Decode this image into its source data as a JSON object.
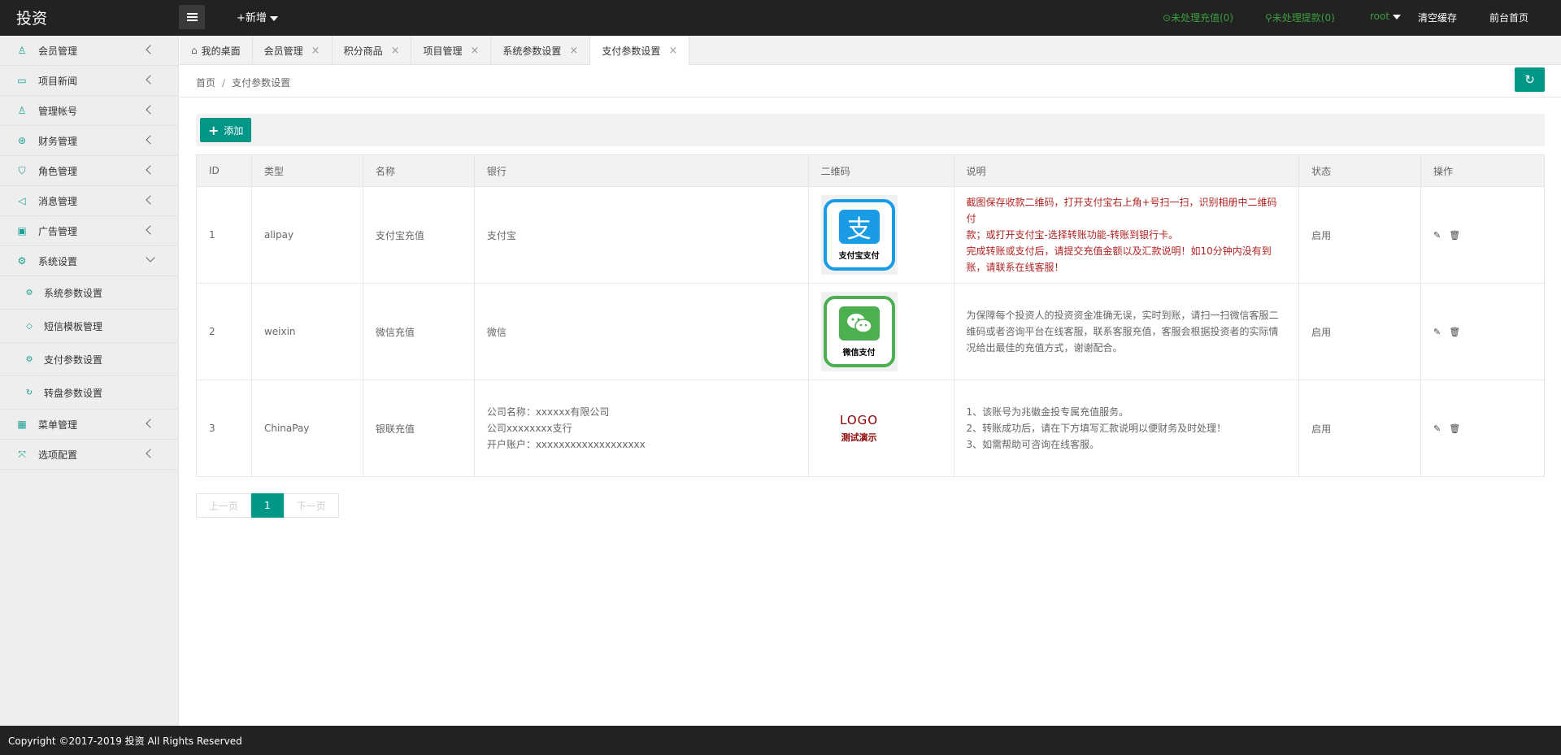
{
  "header": {
    "brand": "投资",
    "new_label": "+新增",
    "pending_recharge": "未处理充值(0)",
    "pending_withdraw": "未处理提款(0)",
    "user": "root",
    "clear_cache": "清空缓存",
    "front_home": "前台首页"
  },
  "sidebar": {
    "items": [
      {
        "label": "会员管理",
        "icon": "user-icon"
      },
      {
        "label": "项目新闻",
        "icon": "book-icon"
      },
      {
        "label": "管理帐号",
        "icon": "account-icon"
      },
      {
        "label": "财务管理",
        "icon": "finance-icon"
      },
      {
        "label": "角色管理",
        "icon": "shield-icon"
      },
      {
        "label": "消息管理",
        "icon": "message-icon"
      },
      {
        "label": "广告管理",
        "icon": "image-icon"
      },
      {
        "label": "系统设置",
        "icon": "gear-icon"
      }
    ],
    "sub_items": [
      {
        "label": "系统参数设置",
        "icon": "gear-icon"
      },
      {
        "label": "短信模板管理",
        "icon": "tag-icon"
      },
      {
        "label": "支付参数设置",
        "icon": "gear-icon"
      },
      {
        "label": "转盘参数设置",
        "icon": "refresh-icon"
      }
    ],
    "bottom_items": [
      {
        "label": "菜单管理",
        "icon": "apps-icon"
      },
      {
        "label": "选项配置",
        "icon": "fork-icon"
      }
    ]
  },
  "tabs": [
    {
      "label": "我的桌面"
    },
    {
      "label": "会员管理"
    },
    {
      "label": "积分商品"
    },
    {
      "label": "项目管理"
    },
    {
      "label": "系统参数设置"
    },
    {
      "label": "支付参数设置"
    }
  ],
  "breadcrumb": {
    "home": "首页",
    "sep": "/",
    "current": "支付参数设置"
  },
  "toolbar": {
    "add_label": "添加"
  },
  "table": {
    "headers": [
      "ID",
      "类型",
      "名称",
      "银行",
      "二维码",
      "说明",
      "状态",
      "操作"
    ],
    "rows": [
      {
        "id": "1",
        "type": "alipay",
        "name": "支付宝充值",
        "bank_lines": [
          "支付宝"
        ],
        "qr_text": "支付宝支付",
        "desc_lines": [
          "截图保存收款二维码，打开支付宝右上角+号扫一扫，识别相册中二维码付",
          "款；或打开支付宝-选择转账功能-转账到银行卡。",
          "完成转账或支付后，请提交充值金额以及汇款说明！如10分钟内没有到",
          "账，请联系在线客服！"
        ],
        "status": "启用"
      },
      {
        "id": "2",
        "type": "weixin",
        "name": "微信充值",
        "bank_lines": [
          "微信"
        ],
        "qr_text": "微信支付",
        "desc_lines": [
          "为保障每个投资人的投资资金准确无误，实时到账，请扫一扫微信客服二",
          "维码或者咨询平台在线客服，联系客服充值，客服会根据投资者的实际情",
          "况给出最佳的充值方式，谢谢配合。"
        ],
        "status": "启用"
      },
      {
        "id": "3",
        "type": "ChinaPay",
        "name": "银联充值",
        "bank_lines": [
          "公司名称：xxxxxx有限公司",
          "公司xxxxxxxx支行",
          "开户账户：xxxxxxxxxxxxxxxxxxx"
        ],
        "qr_logo": "LOGO",
        "qr_sub": "测试演示",
        "desc_lines": [
          "1、该账号为兆徽金投专属充值服务。",
          "2、转账成功后，请在下方填写汇款说明以便财务及时处理！",
          "3、如需帮助可咨询在线客服。"
        ],
        "status": "启用"
      }
    ]
  },
  "pagination": {
    "prev": "上一页",
    "current": "1",
    "next": "下一页"
  },
  "footer": {
    "copyright": "Copyright ©2017-2019 投资 All Rights Reserved"
  }
}
